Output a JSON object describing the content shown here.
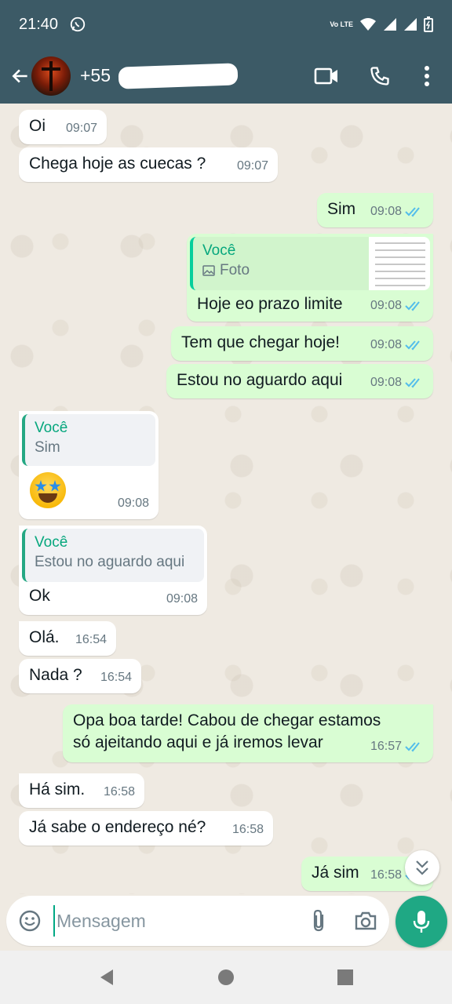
{
  "status_bar": {
    "time": "21:40",
    "network": "Vo LTE"
  },
  "header": {
    "contact": "+55",
    "back_icon": "arrow-left-icon",
    "video_icon": "video-call-icon",
    "call_icon": "phone-icon",
    "menu_icon": "more-vert-icon"
  },
  "colors": {
    "header_bg": "#3c5a66",
    "incoming_bg": "#ffffff",
    "outgoing_bg": "#d9fdd3",
    "accent": "#1fa884",
    "read_ticks": "#53bdeb"
  },
  "messages": [
    {
      "dir": "in",
      "text": "Oi",
      "time": "09:07"
    },
    {
      "dir": "in",
      "text": "Chega hoje as cuecas ?",
      "time": "09:07"
    },
    {
      "dir": "out",
      "text": "Sim",
      "time": "09:08"
    },
    {
      "dir": "out",
      "quote_author": "Você",
      "quote_text": "Foto",
      "text": "Hoje eo prazo limite",
      "time": "09:08"
    },
    {
      "dir": "out",
      "text": "Tem que chegar hoje!",
      "time": "09:08"
    },
    {
      "dir": "out",
      "text": "Estou no aguardo aqui",
      "time": "09:08"
    },
    {
      "dir": "in",
      "quote_author": "Você",
      "quote_text": "Sim",
      "emoji": "star-struck-emoji",
      "time": "09:08"
    },
    {
      "dir": "in",
      "quote_author": "Você",
      "quote_text": "Estou no aguardo aqui",
      "text": "Ok",
      "time": "09:08"
    },
    {
      "dir": "in",
      "text": "Olá.",
      "time": "16:54"
    },
    {
      "dir": "in",
      "text": "Nada ?",
      "time": "16:54"
    },
    {
      "dir": "out",
      "text_line1": "Opa boa tarde! Cabou de chegar estamos",
      "text_line2": "só ajeitando aqui e já iremos levar",
      "time": "16:57"
    },
    {
      "dir": "in",
      "text": "Há sim.",
      "time": "16:58"
    },
    {
      "dir": "in",
      "text": "Já sabe o endereço né?",
      "time": "16:58"
    },
    {
      "dir": "out",
      "text": "Já sim",
      "time": "16:58"
    }
  ],
  "composer": {
    "placeholder": "Mensagem"
  }
}
